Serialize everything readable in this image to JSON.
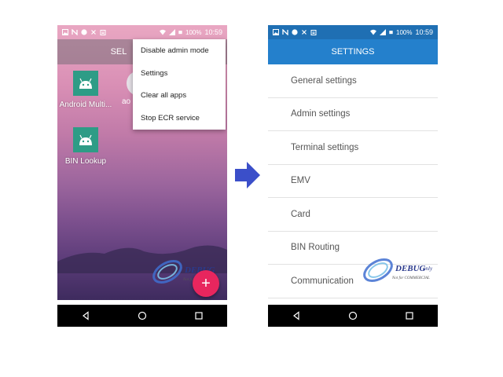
{
  "status_bar": {
    "battery": "100%",
    "time": "10:59"
  },
  "left_screen": {
    "topbar_title_partial": "SEL",
    "apps": [
      {
        "label": "Android Multi..."
      },
      {
        "label": "BIN Lookup"
      }
    ],
    "partial_app_label": "ao",
    "overflow_menu": [
      {
        "label": "Disable admin mode"
      },
      {
        "label": "Settings"
      },
      {
        "label": "Clear all apps"
      },
      {
        "label": "Stop ECR service"
      }
    ],
    "fab_symbol": "+"
  },
  "right_screen": {
    "title": "SETTINGS",
    "items": [
      {
        "label": "General settings"
      },
      {
        "label": "Admin settings"
      },
      {
        "label": "Terminal settings"
      },
      {
        "label": "EMV"
      },
      {
        "label": "Card"
      },
      {
        "label": "BIN Routing"
      },
      {
        "label": "Communication"
      }
    ]
  },
  "watermark": {
    "main": "DEBUG",
    "only": "only",
    "sub": "Not for COMMERCIAL"
  },
  "colors": {
    "appbar": "#2480cc",
    "fab": "#e8265e",
    "arrow": "#3b4fc9",
    "app_icon": "#2e9c86"
  },
  "icons": [
    "image-icon",
    "n-notification-icon",
    "circle-icon",
    "cross-icon",
    "clipboard-icon",
    "wifi-icon",
    "signal-icon",
    "battery-icon",
    "android-icon",
    "back-icon",
    "home-icon",
    "recents-icon",
    "right-arrow-icon"
  ]
}
